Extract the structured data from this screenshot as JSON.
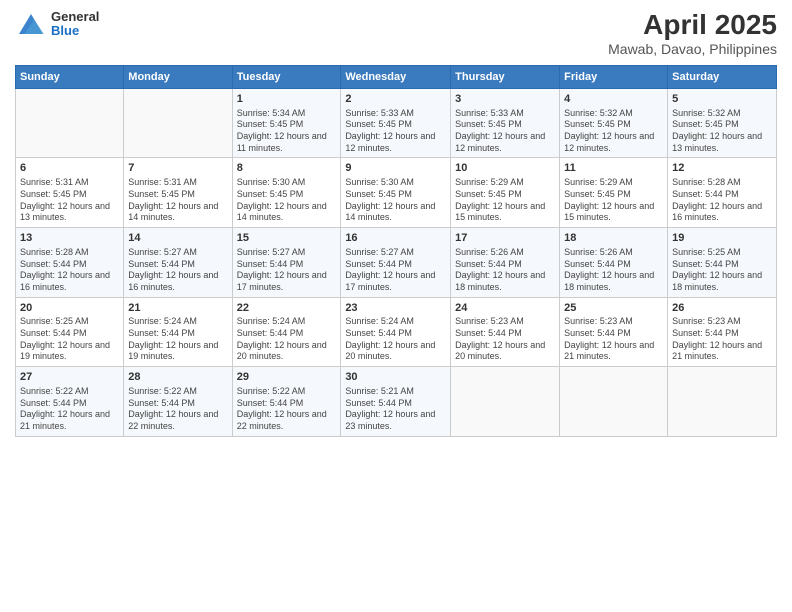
{
  "header": {
    "logo": {
      "general": "General",
      "blue": "Blue"
    },
    "title": "April 2025",
    "subtitle": "Mawab, Davao, Philippines"
  },
  "days_of_week": [
    "Sunday",
    "Monday",
    "Tuesday",
    "Wednesday",
    "Thursday",
    "Friday",
    "Saturday"
  ],
  "weeks": [
    [
      {
        "day": "",
        "sunrise": "",
        "sunset": "",
        "daylight": ""
      },
      {
        "day": "",
        "sunrise": "",
        "sunset": "",
        "daylight": ""
      },
      {
        "day": "1",
        "sunrise": "Sunrise: 5:34 AM",
        "sunset": "Sunset: 5:45 PM",
        "daylight": "Daylight: 12 hours and 11 minutes."
      },
      {
        "day": "2",
        "sunrise": "Sunrise: 5:33 AM",
        "sunset": "Sunset: 5:45 PM",
        "daylight": "Daylight: 12 hours and 12 minutes."
      },
      {
        "day": "3",
        "sunrise": "Sunrise: 5:33 AM",
        "sunset": "Sunset: 5:45 PM",
        "daylight": "Daylight: 12 hours and 12 minutes."
      },
      {
        "day": "4",
        "sunrise": "Sunrise: 5:32 AM",
        "sunset": "Sunset: 5:45 PM",
        "daylight": "Daylight: 12 hours and 12 minutes."
      },
      {
        "day": "5",
        "sunrise": "Sunrise: 5:32 AM",
        "sunset": "Sunset: 5:45 PM",
        "daylight": "Daylight: 12 hours and 13 minutes."
      }
    ],
    [
      {
        "day": "6",
        "sunrise": "Sunrise: 5:31 AM",
        "sunset": "Sunset: 5:45 PM",
        "daylight": "Daylight: 12 hours and 13 minutes."
      },
      {
        "day": "7",
        "sunrise": "Sunrise: 5:31 AM",
        "sunset": "Sunset: 5:45 PM",
        "daylight": "Daylight: 12 hours and 14 minutes."
      },
      {
        "day": "8",
        "sunrise": "Sunrise: 5:30 AM",
        "sunset": "Sunset: 5:45 PM",
        "daylight": "Daylight: 12 hours and 14 minutes."
      },
      {
        "day": "9",
        "sunrise": "Sunrise: 5:30 AM",
        "sunset": "Sunset: 5:45 PM",
        "daylight": "Daylight: 12 hours and 14 minutes."
      },
      {
        "day": "10",
        "sunrise": "Sunrise: 5:29 AM",
        "sunset": "Sunset: 5:45 PM",
        "daylight": "Daylight: 12 hours and 15 minutes."
      },
      {
        "day": "11",
        "sunrise": "Sunrise: 5:29 AM",
        "sunset": "Sunset: 5:45 PM",
        "daylight": "Daylight: 12 hours and 15 minutes."
      },
      {
        "day": "12",
        "sunrise": "Sunrise: 5:28 AM",
        "sunset": "Sunset: 5:44 PM",
        "daylight": "Daylight: 12 hours and 16 minutes."
      }
    ],
    [
      {
        "day": "13",
        "sunrise": "Sunrise: 5:28 AM",
        "sunset": "Sunset: 5:44 PM",
        "daylight": "Daylight: 12 hours and 16 minutes."
      },
      {
        "day": "14",
        "sunrise": "Sunrise: 5:27 AM",
        "sunset": "Sunset: 5:44 PM",
        "daylight": "Daylight: 12 hours and 16 minutes."
      },
      {
        "day": "15",
        "sunrise": "Sunrise: 5:27 AM",
        "sunset": "Sunset: 5:44 PM",
        "daylight": "Daylight: 12 hours and 17 minutes."
      },
      {
        "day": "16",
        "sunrise": "Sunrise: 5:27 AM",
        "sunset": "Sunset: 5:44 PM",
        "daylight": "Daylight: 12 hours and 17 minutes."
      },
      {
        "day": "17",
        "sunrise": "Sunrise: 5:26 AM",
        "sunset": "Sunset: 5:44 PM",
        "daylight": "Daylight: 12 hours and 18 minutes."
      },
      {
        "day": "18",
        "sunrise": "Sunrise: 5:26 AM",
        "sunset": "Sunset: 5:44 PM",
        "daylight": "Daylight: 12 hours and 18 minutes."
      },
      {
        "day": "19",
        "sunrise": "Sunrise: 5:25 AM",
        "sunset": "Sunset: 5:44 PM",
        "daylight": "Daylight: 12 hours and 18 minutes."
      }
    ],
    [
      {
        "day": "20",
        "sunrise": "Sunrise: 5:25 AM",
        "sunset": "Sunset: 5:44 PM",
        "daylight": "Daylight: 12 hours and 19 minutes."
      },
      {
        "day": "21",
        "sunrise": "Sunrise: 5:24 AM",
        "sunset": "Sunset: 5:44 PM",
        "daylight": "Daylight: 12 hours and 19 minutes."
      },
      {
        "day": "22",
        "sunrise": "Sunrise: 5:24 AM",
        "sunset": "Sunset: 5:44 PM",
        "daylight": "Daylight: 12 hours and 20 minutes."
      },
      {
        "day": "23",
        "sunrise": "Sunrise: 5:24 AM",
        "sunset": "Sunset: 5:44 PM",
        "daylight": "Daylight: 12 hours and 20 minutes."
      },
      {
        "day": "24",
        "sunrise": "Sunrise: 5:23 AM",
        "sunset": "Sunset: 5:44 PM",
        "daylight": "Daylight: 12 hours and 20 minutes."
      },
      {
        "day": "25",
        "sunrise": "Sunrise: 5:23 AM",
        "sunset": "Sunset: 5:44 PM",
        "daylight": "Daylight: 12 hours and 21 minutes."
      },
      {
        "day": "26",
        "sunrise": "Sunrise: 5:23 AM",
        "sunset": "Sunset: 5:44 PM",
        "daylight": "Daylight: 12 hours and 21 minutes."
      }
    ],
    [
      {
        "day": "27",
        "sunrise": "Sunrise: 5:22 AM",
        "sunset": "Sunset: 5:44 PM",
        "daylight": "Daylight: 12 hours and 21 minutes."
      },
      {
        "day": "28",
        "sunrise": "Sunrise: 5:22 AM",
        "sunset": "Sunset: 5:44 PM",
        "daylight": "Daylight: 12 hours and 22 minutes."
      },
      {
        "day": "29",
        "sunrise": "Sunrise: 5:22 AM",
        "sunset": "Sunset: 5:44 PM",
        "daylight": "Daylight: 12 hours and 22 minutes."
      },
      {
        "day": "30",
        "sunrise": "Sunrise: 5:21 AM",
        "sunset": "Sunset: 5:44 PM",
        "daylight": "Daylight: 12 hours and 23 minutes."
      },
      {
        "day": "",
        "sunrise": "",
        "sunset": "",
        "daylight": ""
      },
      {
        "day": "",
        "sunrise": "",
        "sunset": "",
        "daylight": ""
      },
      {
        "day": "",
        "sunrise": "",
        "sunset": "",
        "daylight": ""
      }
    ]
  ]
}
